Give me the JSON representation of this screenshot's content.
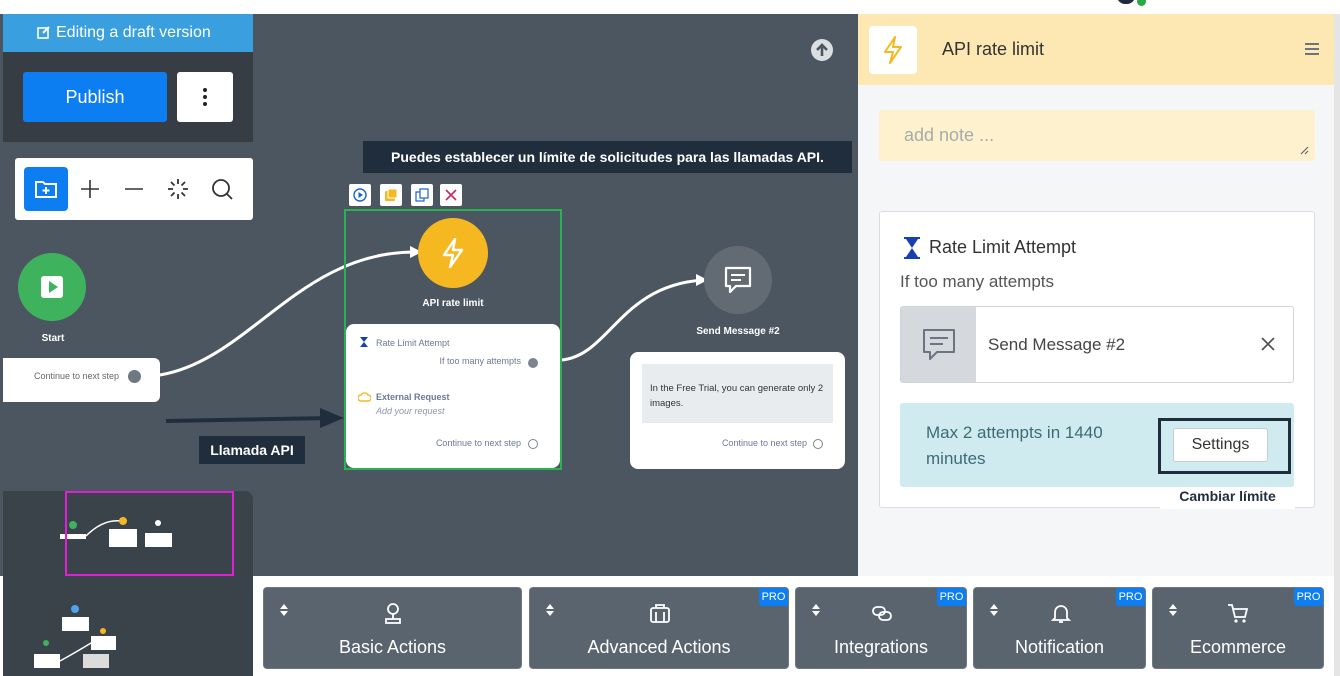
{
  "banner": {
    "text": "Editing a draft version"
  },
  "publish": {
    "label": "Publish"
  },
  "tooltip": {
    "text": "Puedes establecer un límite de solicitudes para las llamadas API."
  },
  "start": {
    "label": "Start",
    "continue": "Continue to next step"
  },
  "api_node": {
    "label": "API rate limit",
    "rate_limit_title": "Rate Limit Attempt",
    "rate_limit_sub": "If too many attempts",
    "external_title": "External Request",
    "external_sub": "Add your request",
    "continue": "Continue to next step"
  },
  "message_node": {
    "label": "Send Message #2",
    "text": "In the Free Trial, you can generate only 2 images.",
    "continue": "Continue to next step"
  },
  "annotation": {
    "arrow_label": "Llamada API",
    "change_limit": "Cambiar límite"
  },
  "actions": [
    {
      "label": "Basic Actions",
      "pro": "",
      "icon": "user-pin-icon"
    },
    {
      "label": "Advanced Actions",
      "pro": "PRO",
      "icon": "briefcase-icon"
    },
    {
      "label": "Integrations",
      "pro": "PRO",
      "icon": "link-icon"
    },
    {
      "label": "Notification",
      "pro": "PRO",
      "icon": "bell-icon"
    },
    {
      "label": "Ecommerce",
      "pro": "PRO",
      "icon": "cart-icon"
    }
  ],
  "panel": {
    "title": "API rate limit",
    "note_placeholder": "add note ...",
    "rate_limit_title": "Rate Limit Attempt",
    "rate_limit_sub": "If too many attempts",
    "target_name": "Send Message #2",
    "limit_text": "Max 2 attempts in 1440 minutes",
    "settings": "Settings"
  },
  "colors": {
    "accent": "#0d7df2",
    "api": "#f5b820",
    "start": "#3eb25d",
    "selection": "#27b354"
  }
}
